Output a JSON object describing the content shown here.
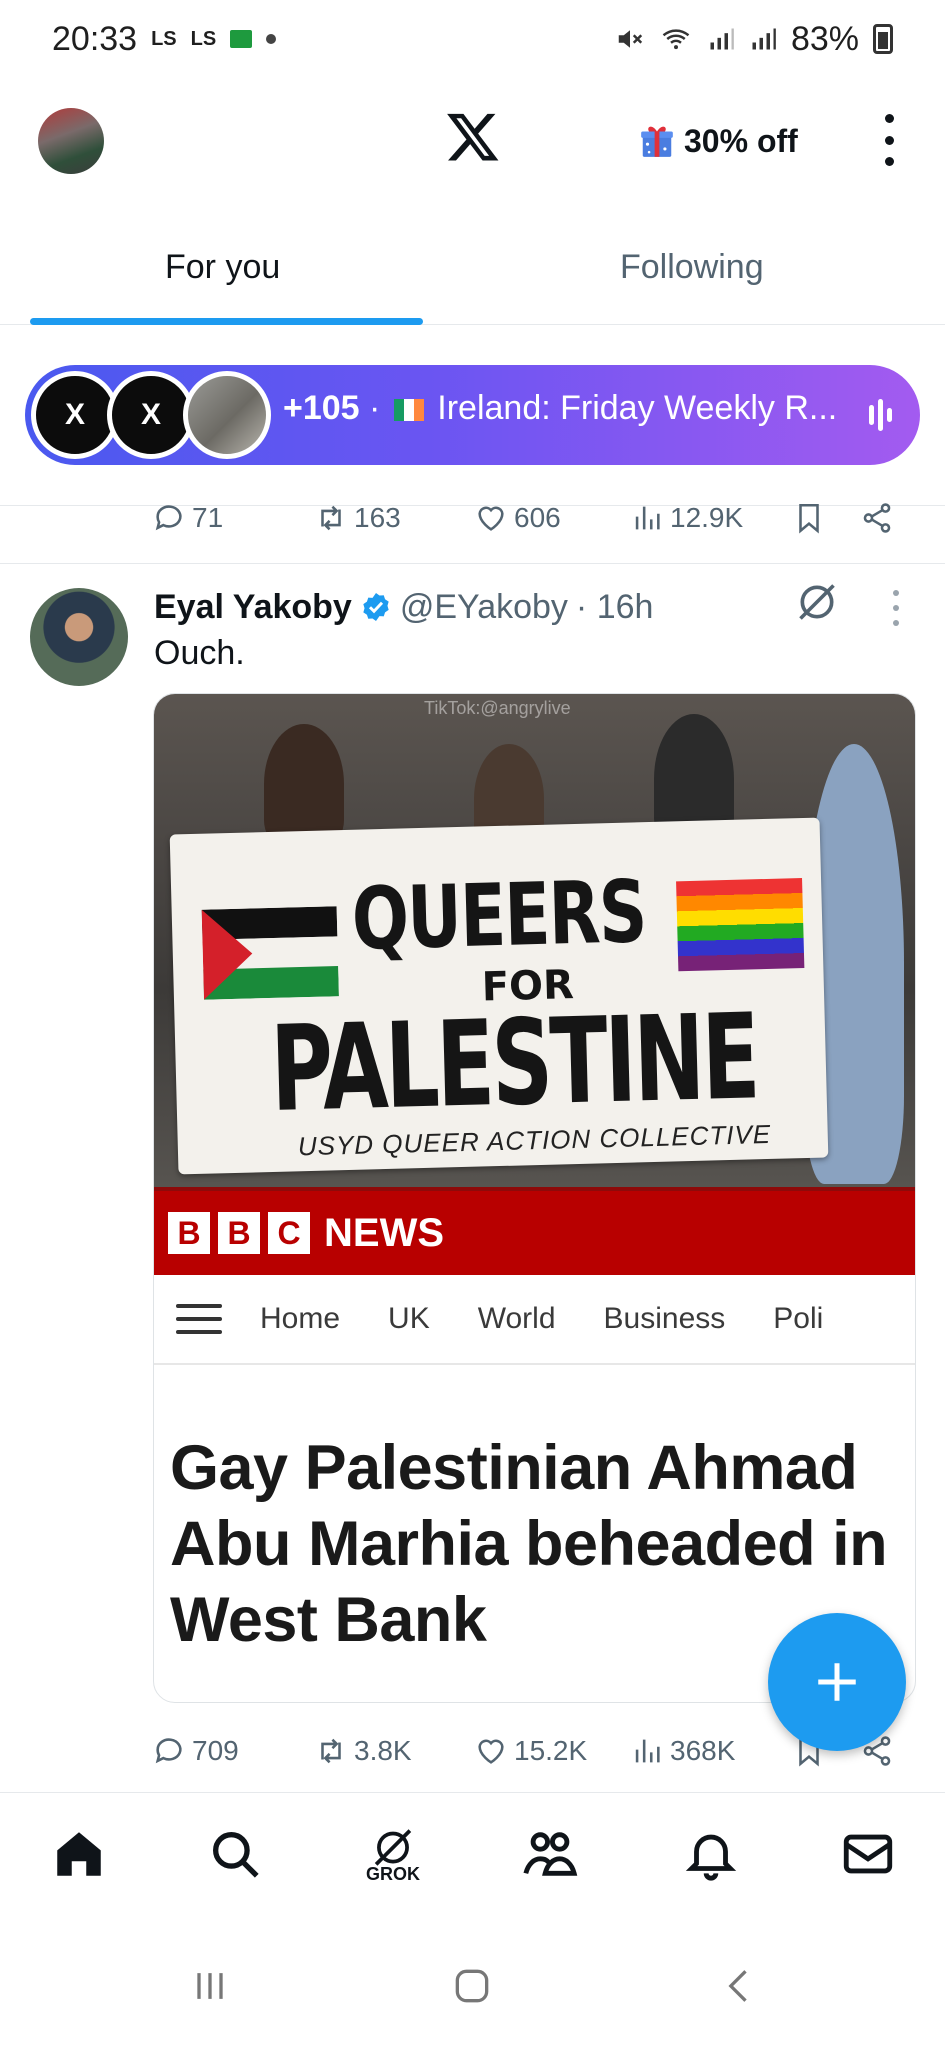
{
  "status_bar": {
    "time": "20:33",
    "badge1": "LS",
    "badge2": "LS",
    "battery": "83%"
  },
  "header": {
    "promo_label": "30% off"
  },
  "tabs": [
    {
      "label": "For you",
      "active": true
    },
    {
      "label": "Following",
      "active": false
    }
  ],
  "spaces": {
    "count": "+105",
    "separator": "·",
    "title": "Ireland: Friday Weekly R..."
  },
  "prev_tweet_actions": {
    "replies": "71",
    "reposts": "163",
    "likes": "606",
    "views": "12.9K"
  },
  "tweet": {
    "name": "Eyal Yakoby",
    "handle": "@EYakoby",
    "time": "· 16h",
    "text": "Ouch.",
    "media": {
      "watermark": "TikTok:@angrylive",
      "banner_line1": "QUEERS",
      "banner_line2": "FOR",
      "banner_line3": "PALESTINE",
      "banner_line4": "USYD QUEER ACTION COLLECTIVE",
      "bbc_letters": [
        "B",
        "B",
        "C"
      ],
      "bbc_news": "NEWS",
      "nav": [
        "Home",
        "UK",
        "World",
        "Business",
        "Poli"
      ],
      "headline": "Gay Palestinian Ahmad Abu Marhia beheaded in West Bank"
    },
    "actions": {
      "replies": "709",
      "reposts": "3.8K",
      "likes": "15.2K",
      "views": "368K"
    }
  },
  "bottom_nav": {
    "grok_label": "GROK"
  },
  "colors": {
    "accent": "#1d9bf0",
    "spaces_start": "#4a59ef",
    "spaces_end": "#a35bf0",
    "bbc_red": "#b80000"
  }
}
